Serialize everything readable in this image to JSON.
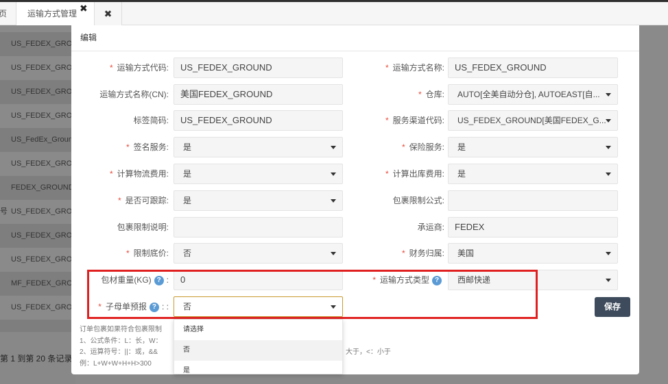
{
  "tabs": {
    "partial_label": "页",
    "active_label": "运输方式管理",
    "close_glyph": "✖",
    "extra_glyph": "✖"
  },
  "background_table": {
    "row_prefix_label": "号",
    "rows": [
      "US_FEDEX_GROUND",
      "US_FEDEX_GROUND",
      "US_FEDEX_GROUND",
      "US_FEDEX_GROUND",
      "US_FedEx_Ground",
      "US_FEDEX_GROUND",
      "FEDEX_GROUND_",
      "US_FEDEX_GROUND",
      "US_FEDEX_GROUND",
      "US_FEDEX_GROUND",
      "MF_FEDEX_GROUND",
      "US_FEDEX_GROUND"
    ],
    "pagination": "第 1 到第 20 条记录"
  },
  "modal": {
    "title": "编辑",
    "required_mark": "*",
    "fields": {
      "ship_code": {
        "label": "运输方式代码:",
        "value": "US_FEDEX_GROUND"
      },
      "ship_name": {
        "label": "运输方式名称:",
        "value": "US_FEDEX_GROUND"
      },
      "ship_name_cn": {
        "label": "运输方式名称(CN):",
        "value": "美国FEDEX_GROUND"
      },
      "warehouse": {
        "label": "仓库:",
        "value": "AUTO[全美自动分仓], AUTOEAST[自..."
      },
      "tag_short": {
        "label": "标签简码:",
        "value": "US_FEDEX_GROUND"
      },
      "service_channel": {
        "label": "服务渠道代码:",
        "value": "US_FEDEX_GROUND[美国FEDEX_G..."
      },
      "signature": {
        "label": "签名服务:",
        "value": "是"
      },
      "insurance": {
        "label": "保险服务:",
        "value": "是"
      },
      "calc_logistics_fee": {
        "label": "计算物流费用:",
        "value": "是"
      },
      "calc_outbound_fee": {
        "label": "计算出库费用:",
        "value": "是"
      },
      "trackable": {
        "label": "是否可跟踪:",
        "value": "是"
      },
      "package_formula": {
        "label": "包裹限制公式:",
        "value": ""
      },
      "package_desc": {
        "label": "包裹限制说明:",
        "value": ""
      },
      "carrier": {
        "label": "承运商:",
        "value": "FEDEX"
      },
      "min_price": {
        "label": "限制底价:",
        "value": "否"
      },
      "finance": {
        "label": "财务归属:",
        "value": "美国"
      },
      "pack_weight": {
        "label": "包材重量(KG)",
        "suffix": ":",
        "value": "0"
      },
      "ship_type": {
        "label": "运输方式类型",
        "value": "西邮快递"
      },
      "mother_child": {
        "label": "子母单预报",
        "suffix": ": :",
        "value": "否"
      }
    },
    "help_glyph": "?",
    "save_label": "保存",
    "notes": {
      "line1": "订单包裹如果符合包裹限制",
      "line2": "1、公式条件：L：长，W：",
      "line3": "2、运算符号：||：或，&&",
      "line3_tail": "大于，<：小于",
      "line4": "例：L+W+W+H+H>300"
    },
    "dropdown_options": [
      "请选择",
      "否",
      "是"
    ]
  }
}
